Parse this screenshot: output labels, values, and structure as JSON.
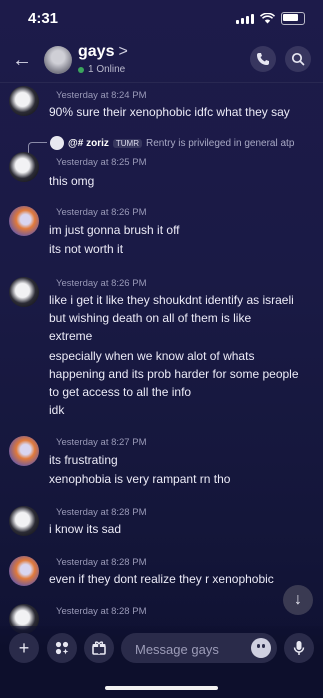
{
  "status": {
    "time": "4:31"
  },
  "header": {
    "title": "gays",
    "chevron": ">",
    "online": "1 Online"
  },
  "reply": {
    "name": "@# zoriz",
    "tag": "TUMR",
    "text": "Rentry is privileged in general atp"
  },
  "messages": [
    {
      "time": "Yesterday at 8:24 PM",
      "lines": [
        "90% sure their xenophobic idfc what they say"
      ]
    },
    {
      "time": "Yesterday at 8:25 PM",
      "lines": [
        "this omg"
      ]
    },
    {
      "time": "Yesterday at 8:26 PM",
      "lines": [
        "im just gonna brush it off",
        "its not worth it"
      ]
    },
    {
      "time": "Yesterday at 8:26 PM",
      "lines": [
        "like i get it like they shoukdnt identify as israeli",
        "but wishing death on all of them is like",
        "extreme",
        "especially when we know alot of whats",
        "happening and its prob harder for some people",
        "to get access to all the info",
        "idk"
      ]
    },
    {
      "time": "Yesterday at 8:27 PM",
      "lines": [
        "its frustrating",
        "xenophobia is very rampant rn tho"
      ]
    },
    {
      "time": "Yesterday at 8:28 PM",
      "lines": [
        "i know its sad"
      ]
    },
    {
      "time": "Yesterday at 8:28 PM",
      "lines": [
        "even if they dont realize they r xenophobic"
      ]
    },
    {
      "time": "Yesterday at 8:28 PM",
      "lines": []
    }
  ],
  "composer": {
    "placeholder": "Message gays"
  },
  "colors": {
    "background": "#1a1a45",
    "online": "#3ba55d",
    "input": "#2a2b4a"
  }
}
